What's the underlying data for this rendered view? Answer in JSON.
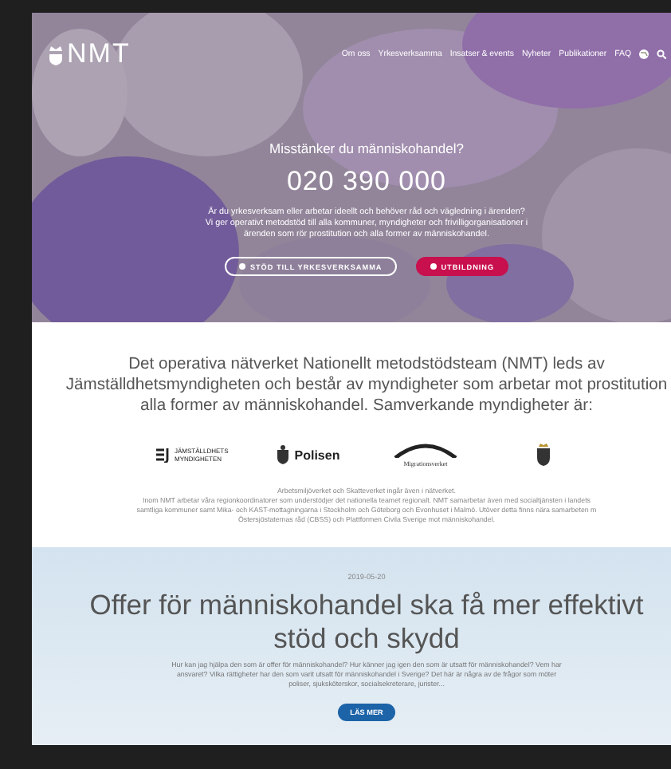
{
  "header": {
    "logo": "NMT",
    "nav": [
      {
        "label": "Om oss"
      },
      {
        "label": "Yrkesverksamma"
      },
      {
        "label": "Insatser & events"
      },
      {
        "label": "Nyheter"
      },
      {
        "label": "Publikationer"
      },
      {
        "label": "FAQ"
      }
    ]
  },
  "hero": {
    "question": "Misstänker du människohandel?",
    "phone": "020 390 000",
    "lines": [
      "Är du yrkesverksam eller arbetar ideellt och behöver råd och vägledning i ärenden?",
      "Vi ger operativt metodstöd till alla kommuner, myndigheter och frivilligorganisationer i",
      "ärenden som rör prostitution och alla former av människohandel."
    ],
    "buttons": [
      {
        "label": "STÖD TILL YRKESVERKSAMMA",
        "kind": "outline"
      },
      {
        "label": "UTBILDNING",
        "kind": "filled"
      }
    ]
  },
  "intro": {
    "lines": [
      "Det operativa nätverket Nationellt metodstödsteam (NMT) leds av",
      "Jämställdhetsmyndigheten och består av myndigheter som arbetar mot prostitution",
      "alla former av människohandel. Samverkande myndigheter är:"
    ],
    "agencies": [
      {
        "kind": "jamstalldhet",
        "label": "JÄMSTÄLLDHETS MYNDIGHETEN"
      },
      {
        "kind": "polisen",
        "label": "Polisen"
      },
      {
        "kind": "migration",
        "label": "Migrationsverket"
      },
      {
        "kind": "crest"
      }
    ],
    "notes": [
      "Arbetsmiljöverket och Skatteverket ingår även i nätverket.",
      "Inom NMT arbetar våra regionkoordinatorer som understödjer det nationella teamet regionalt. NMT samarbetar även med socialtjänsten i landets",
      "samtliga kommuner samt Mika- och KAST-mottagningarna i Stockholm och Göteborg och Evonhuset i Malmö. Utöver detta finns nära samarbeten m",
      "Östersjöstaternas råd (CBSS) och Plattformen Civila Sverige mot människohandel."
    ]
  },
  "news": {
    "date": "2019-05-20",
    "title_lines": [
      "Offer för människohandel ska få mer effektivt",
      "stöd och skydd"
    ],
    "lines": [
      "Hur kan jag hjälpa den som är offer för människohandel? Hur känner jag igen den som är utsatt för människohandel? Vem har",
      "ansvaret? Vilka rättigheter har den som varit utsatt för människohandel i Sverige? Det här är några av de frågor som möter",
      "poliser, sjuksköterskor, socialsekreterare, jurister..."
    ],
    "button": "LÄS MER"
  }
}
